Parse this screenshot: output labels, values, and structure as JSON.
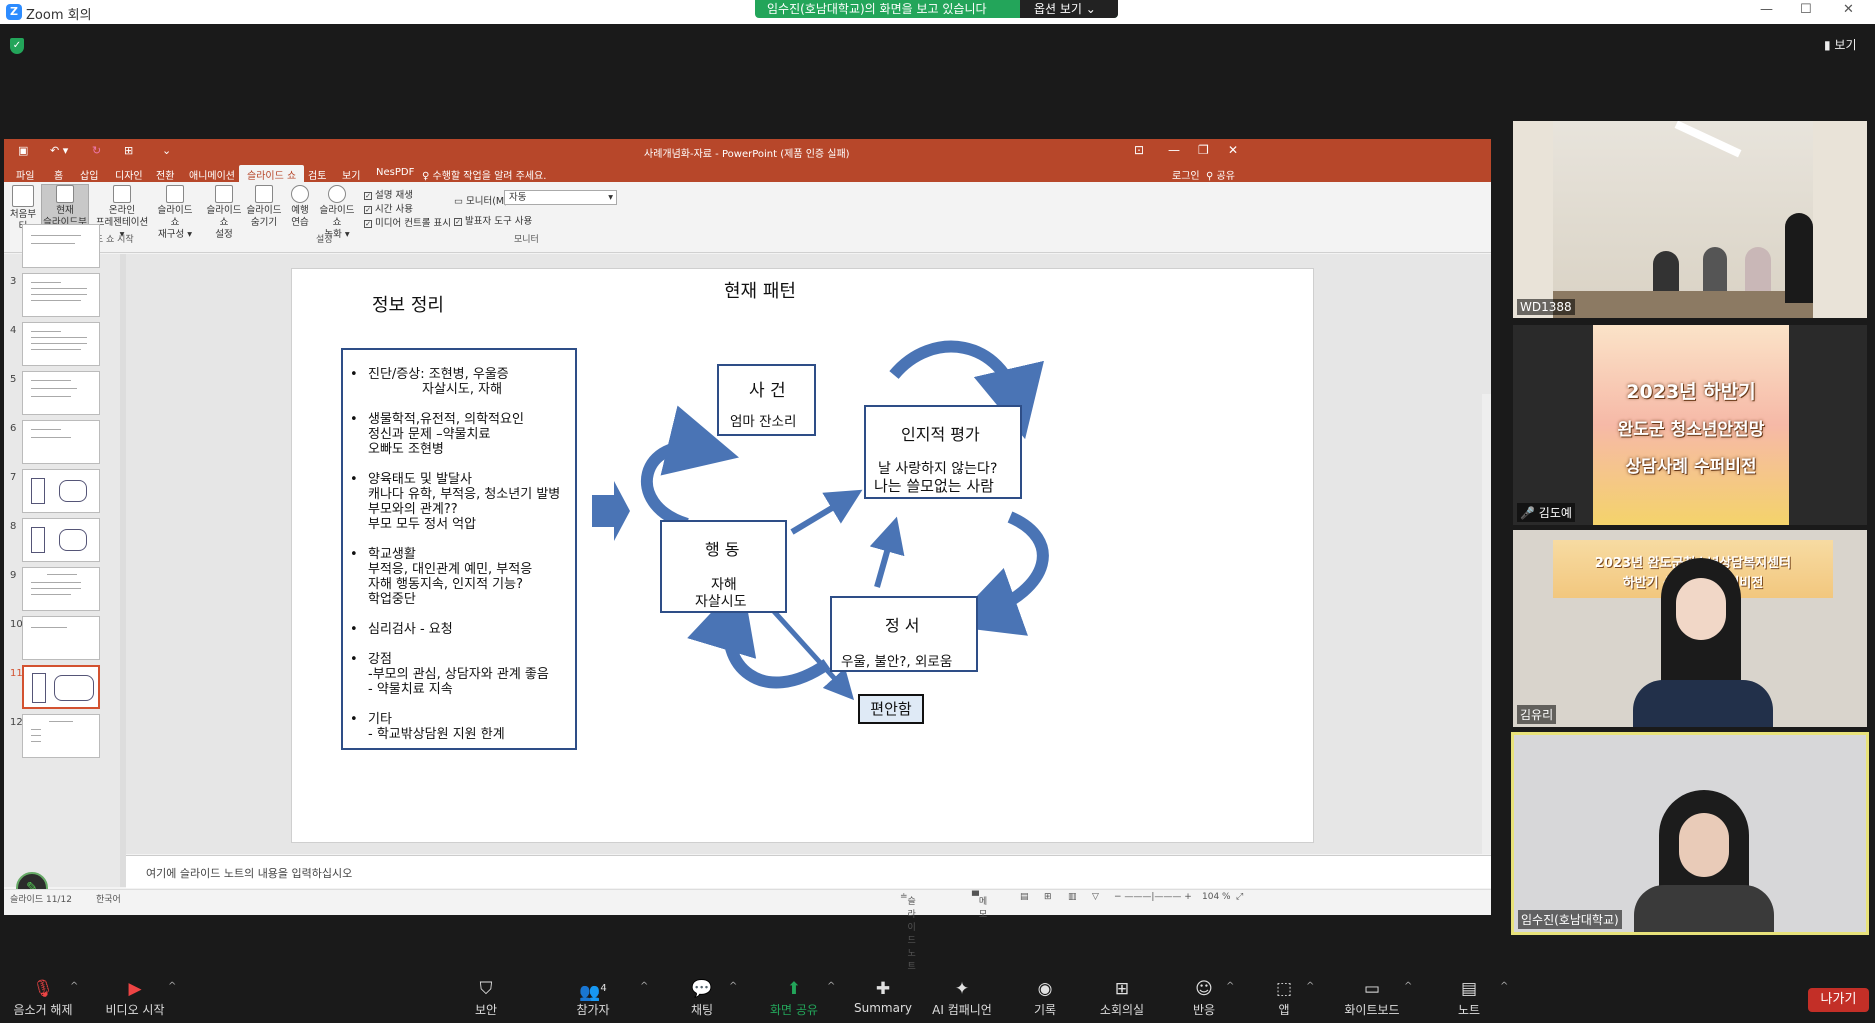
{
  "zoom": {
    "window_title": "Zoom 회의",
    "share_banner": "임수진(호남대학교)의 화면을 보고 있습니다",
    "view_options": "옵션 보기",
    "view_button": "보기"
  },
  "ppt": {
    "title": "사례개념화-자료 - PowerPoint (제품 인증 실패)",
    "tabs": [
      "파일",
      "홈",
      "삽입",
      "디자인",
      "전환",
      "애니메이션",
      "슬라이드 쇼",
      "검토",
      "보기",
      "NesPDF"
    ],
    "active_tab": "슬라이드 쇼",
    "search": "수행할 작업을 알려 주세요.",
    "login": "로그인",
    "share": "공유",
    "ribbon": {
      "btn_start": "처음부터",
      "btn_current_1": "현재",
      "btn_current_2": "슬라이드부터",
      "btn_online_1": "온라인",
      "btn_online_2": "프레젠테이션",
      "btn_custom_1": "슬라이드 쇼",
      "btn_custom_2": "재구성",
      "btn_setup_1": "슬라이드 쇼",
      "btn_setup_2": "설정",
      "btn_hide_1": "슬라이드",
      "btn_hide_2": "숨기기",
      "btn_rehearse_1": "예행",
      "btn_rehearse_2": "연습",
      "btn_record_1": "슬라이드 쇼",
      "btn_record_2": "녹화",
      "chk_narration": "설명 재생",
      "chk_timing": "시간 사용",
      "chk_media": "미디어 컨트롤 표시",
      "monitor_label": "모니터(M):",
      "monitor_value": "자동",
      "chk_presenter": "발표자 도구 사용",
      "group_start": "슬라이드 쇼 시작",
      "group_setup": "설정",
      "group_monitor": "모니터"
    },
    "thumb_numbers": [
      "3",
      "4",
      "5",
      "6",
      "7",
      "8",
      "9",
      "10",
      "11",
      "12"
    ],
    "notes_placeholder": "여기에 슬라이드 노트의 내용을 입력하십시오",
    "status": {
      "slide": "슬라이드 11/12",
      "lang": "한국어",
      "notes": "슬라이드 노트",
      "memo": "메모",
      "zoom": "104 %"
    }
  },
  "slide": {
    "left_title": "정보 정리",
    "right_title": "현재 패턴",
    "bullets": [
      {
        "lines": [
          "진단/증상: 조현병, 우울증",
          "자살시도, 자해"
        ]
      },
      {
        "lines": [
          "생물학적,유전적,   의학적요인",
          "정신과 문제 –약물치료",
          "오빠도 조현병"
        ]
      },
      {
        "lines": [
          "양육태도 및 발달사",
          "캐나다 유학, 부적응, 청소년기 발병",
          "부모와의 관계??",
          "부모 모두 정서 억압"
        ]
      },
      {
        "lines": [
          "학교생활",
          "부적응, 대인관계 예민, 부적응",
          "자해 행동지속, 인지적 기능?",
          "학업중단"
        ]
      },
      {
        "lines": [
          "심리검사   - 요청"
        ]
      },
      {
        "lines": [
          "강점",
          "-부모의 관심, 상담자와 관계 좋음",
          " - 약물치료 지속"
        ]
      },
      {
        "lines": [
          "기타",
          "- 학교밖상담원 지원 한계"
        ]
      }
    ],
    "nodes": {
      "event_title": "사 건",
      "event_body": "엄마 잔소리",
      "cog_title": "인지적 평가",
      "cog_line1": "날 사랑하지 않는다?",
      "cog_line2": "나는 쓸모없는 사람",
      "act_title": "행 동",
      "act_line1": "자해",
      "act_line2": "자살시도",
      "emo_title": "정 서",
      "emo_body": "우울,  불안?, 외로움",
      "relief": "편안함"
    }
  },
  "participants": [
    {
      "name": "WD1388"
    },
    {
      "name": "김도예",
      "banner_line1": "2023년 하반기",
      "banner_line2": "완도군 청소년안전망",
      "banner_line3": "상담사례 수퍼비전"
    },
    {
      "name": "김유리",
      "bg_line1": "2023년 완도군청소년상담복지센터",
      "bg_line2": "하반기 상담사례 수퍼비전"
    },
    {
      "name": "임수진(호남대학교)"
    }
  ],
  "toolbar": {
    "mute": "음소거 해제",
    "video": "비디오 시작",
    "security": "보안",
    "participants": "참가자",
    "participants_count": "4",
    "chat": "채팅",
    "share": "화면 공유",
    "summary": "Summary",
    "ai": "AI 컴패니언",
    "record": "기록",
    "breakout": "소회의실",
    "reactions": "반응",
    "apps": "앱",
    "whiteboard": "화이트보드",
    "notes": "노트",
    "leave": "나가기"
  },
  "colors": {
    "ppt_accent": "#b7472a",
    "share_green": "#23a55a",
    "node_border": "#2e4e87",
    "arrow_blue": "#4a74b5",
    "leave_red": "#c32f27",
    "active_speaker": "#e8e27a"
  }
}
